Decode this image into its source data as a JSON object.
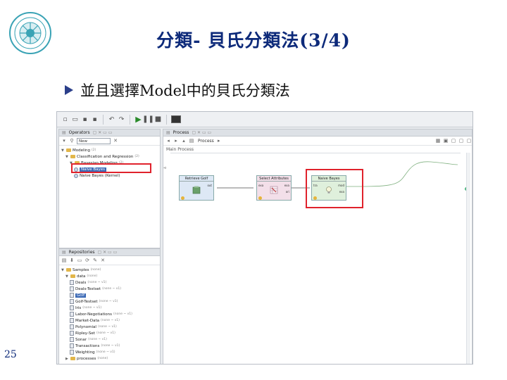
{
  "slide": {
    "title": "分類- 貝氏分類法(3/4)",
    "bullet": "並且選擇Model中的貝氏分類法",
    "page_number": "25"
  },
  "app": {
    "operators_panel": {
      "tab_label": "Operators",
      "search_value": "New",
      "tree": [
        {
          "label": "Modeling",
          "meta": "(2)"
        },
        {
          "label": "Classification and Regression",
          "meta": "(2)"
        },
        {
          "label": "Bayesian Modeling",
          "meta": "(2)"
        },
        {
          "label": "Naive Bayes",
          "meta": "",
          "selected": true
        },
        {
          "label": "Naive Bayes (Kernel)",
          "meta": ""
        }
      ]
    },
    "repositories_panel": {
      "tab_label": "Repositories",
      "tree": [
        {
          "label": "Samples",
          "meta": "(none)"
        },
        {
          "label": "data",
          "meta": "(none)"
        },
        {
          "label": "Deals",
          "meta": "(none ~ v1)"
        },
        {
          "label": "Deals-Testset",
          "meta": "(none ~ v1)"
        },
        {
          "label": "Golf",
          "meta": "",
          "selected": true
        },
        {
          "label": "Golf-Testset",
          "meta": "(none ~ v1)"
        },
        {
          "label": "Iris",
          "meta": "(none ~ v1)"
        },
        {
          "label": "Labor-Negotiations",
          "meta": "(none ~ v1)"
        },
        {
          "label": "Market-Data",
          "meta": "(none ~ v1)"
        },
        {
          "label": "Polynomial",
          "meta": "(none ~ v1)"
        },
        {
          "label": "Ripley-Set",
          "meta": "(none ~ v1)"
        },
        {
          "label": "Sonar",
          "meta": "(none ~ v1)"
        },
        {
          "label": "Transactions",
          "meta": "(none ~ v1)"
        },
        {
          "label": "Weighting",
          "meta": "(none ~ v1)"
        },
        {
          "label": "processes",
          "meta": "(none)"
        }
      ]
    },
    "process_panel": {
      "tab_label": "Process",
      "path_label": "Process",
      "canvas_label": "Main Process",
      "operators": [
        {
          "name": "Retrieve Golf",
          "ports_out": [
            "out"
          ]
        },
        {
          "name": "Select Attributes",
          "ports_in": [
            "exa"
          ],
          "ports_out": [
            "exa",
            "ori"
          ]
        },
        {
          "name": "Naive Bayes",
          "ports_in": [
            "tra"
          ],
          "ports_out": [
            "mod",
            "exa"
          ]
        }
      ]
    }
  }
}
